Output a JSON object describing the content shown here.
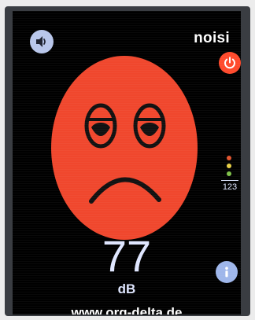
{
  "app": {
    "name": "noisi"
  },
  "controls": {
    "speaker_icon": "speaker-icon",
    "power_icon": "power-icon",
    "info_icon": "info-icon"
  },
  "face": {
    "mood": "sad",
    "color": "#f0472d"
  },
  "level_indicator": {
    "label": "123",
    "dots": [
      "#e2542e",
      "#e8cf46",
      "#7fc24a"
    ]
  },
  "measurement": {
    "value": "77",
    "unit": "dB"
  },
  "footer": {
    "website": "www.org-delta.de"
  },
  "colors": {
    "accent_red": "#ff4a2c",
    "button_blue": "#9eb6ea",
    "text_light": "#dfe6ff"
  }
}
